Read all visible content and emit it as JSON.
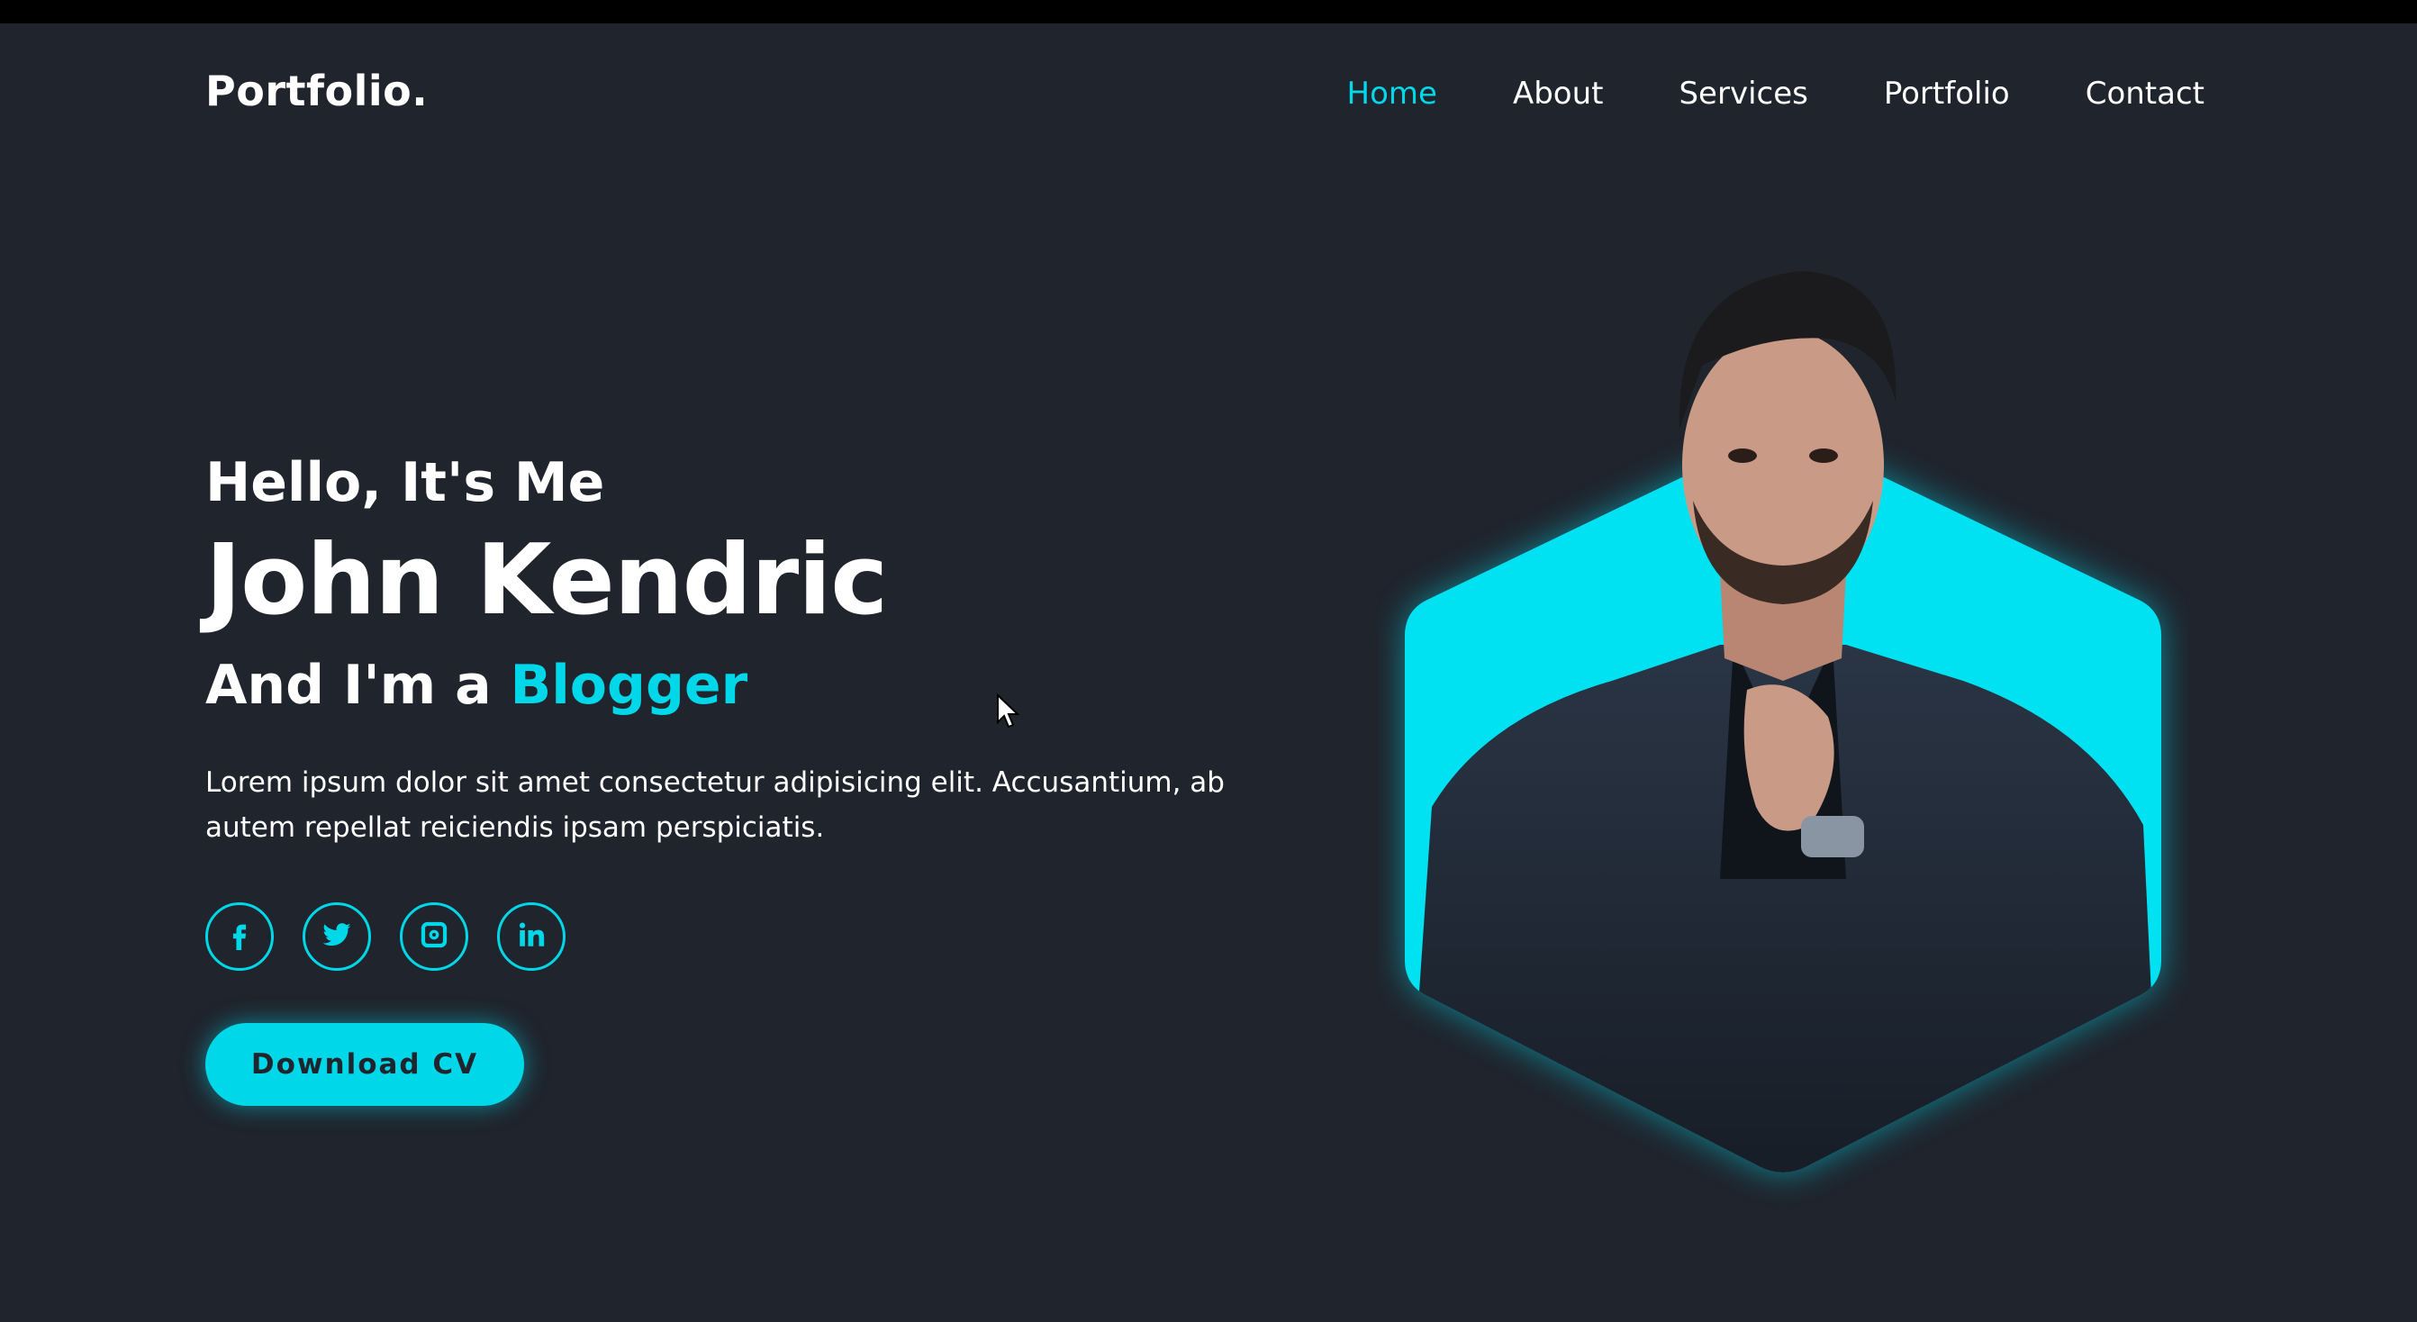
{
  "brand": {
    "logo": "Portfolio."
  },
  "nav": [
    {
      "label": "Home",
      "active": true
    },
    {
      "label": "About"
    },
    {
      "label": "Services"
    },
    {
      "label": "Portfolio"
    },
    {
      "label": "Contact"
    }
  ],
  "hero": {
    "greeting": "Hello, It's Me",
    "name": "John Kendric",
    "role_prefix": "And I'm a ",
    "role": "Blogger",
    "description": "Lorem ipsum dolor sit amet consectetur adipisicing elit. Accusantium, ab autem repellat reiciendis ipsam perspiciatis.",
    "cta": "Download CV"
  },
  "socials": [
    "facebook-icon",
    "twitter-icon",
    "instagram-icon",
    "linkedin-icon"
  ],
  "colors": {
    "background": "#1f242d",
    "accent": "#00d7e8",
    "text": "#ffffff"
  }
}
